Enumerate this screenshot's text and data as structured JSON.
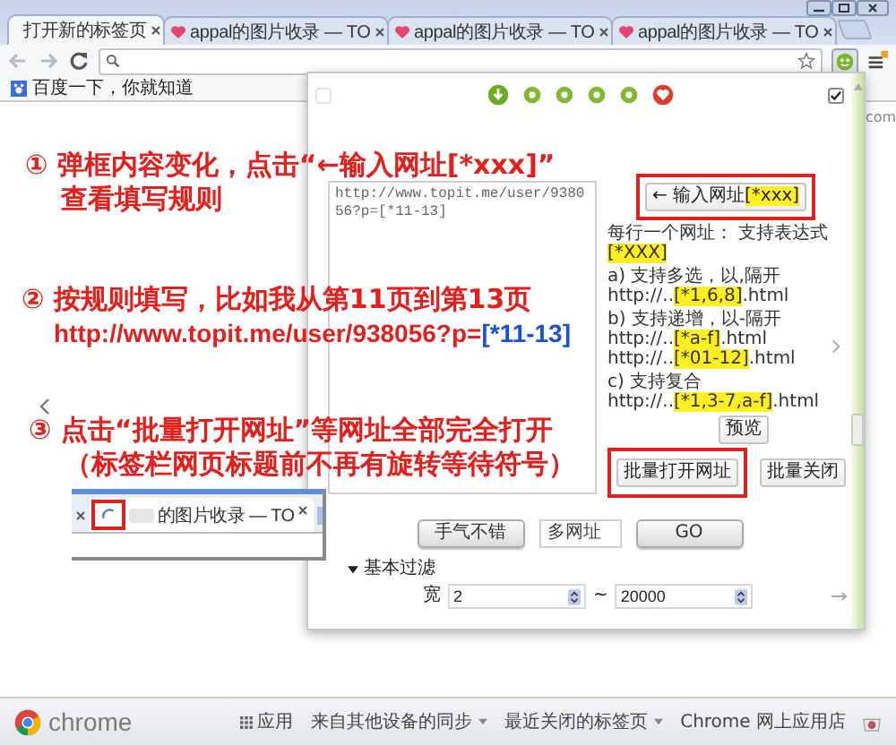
{
  "browser": {
    "tabs": [
      {
        "title": "打开新的标签页",
        "selected": true,
        "kind": "plain"
      },
      {
        "title": "appal的图片收录 — TO",
        "selected": false,
        "kind": "heart"
      },
      {
        "title": "appal的图片收录 — TO",
        "selected": false,
        "kind": "heart"
      },
      {
        "title": "appal的图片收录 — TO",
        "selected": false,
        "kind": "heart"
      }
    ],
    "bookmarks": [
      {
        "label": "百度一下，你就知道"
      }
    ]
  },
  "page": {
    "peek_text": "com",
    "footer_brand": "chrome",
    "footer_links": [
      {
        "label": "应用",
        "kind": "apps"
      },
      {
        "label": "来自其他设备的同步",
        "kind": "menu"
      },
      {
        "label": "最近关闭的标签页",
        "kind": "menu"
      },
      {
        "label": "Chrome 网上应用店",
        "kind": "store"
      }
    ]
  },
  "popup": {
    "options": [
      {
        "checked": false
      },
      {
        "checked": true
      }
    ],
    "url_text": "http://www.topit.me/user/938056?p=[*11-13]",
    "input_button": {
      "marked": true,
      "parts": [
        {
          "text": "← 输入网址",
          "highlight": false
        },
        {
          "text": "[*xxx]",
          "highlight": true
        }
      ]
    },
    "help_blocks": [
      {
        "lines": [
          [
            {
              "text": "每行一个网址：  支持表达式 ",
              "highlight": false
            },
            {
              "text": "[*XXX]",
              "highlight": true
            }
          ]
        ]
      },
      {
        "lines": [
          [
            {
              "text": "a) 支持多选，以,隔开",
              "highlight": false
            }
          ],
          [
            {
              "text": "http://..",
              "highlight": false
            },
            {
              "text": "[*1,6,8]",
              "highlight": true
            },
            {
              "text": ".html",
              "highlight": false
            }
          ]
        ]
      },
      {
        "lines": [
          [
            {
              "text": "b) 支持递增，以-隔开",
              "highlight": false
            }
          ],
          [
            {
              "text": "http://..",
              "highlight": false
            },
            {
              "text": "[*a-f]",
              "highlight": true
            },
            {
              "text": ".html",
              "highlight": false
            }
          ],
          [
            {
              "text": "http://..",
              "highlight": false
            },
            {
              "text": "[*01-12]",
              "highlight": true
            },
            {
              "text": ".html",
              "highlight": false
            }
          ]
        ]
      },
      {
        "lines": [
          [
            {
              "text": "c) 支持复合",
              "highlight": false
            }
          ],
          [
            {
              "text": "http://..",
              "highlight": false
            },
            {
              "text": "[*1,3-7,a-f]",
              "highlight": true
            },
            {
              "text": ".html",
              "highlight": false
            }
          ]
        ]
      }
    ],
    "preview_button": "预览",
    "batch_buttons": [
      {
        "label": "批量打开网址",
        "marked": true
      },
      {
        "label": "批量关闭",
        "marked": false
      }
    ],
    "lucky_button": "手气不错",
    "mode_field": "多网址",
    "go_button": "GO",
    "filter": {
      "title": "基本过滤",
      "expanded": true,
      "label": "宽",
      "min": "2",
      "separator": "~",
      "max": "20000"
    }
  },
  "annotations": [
    {
      "lines": [
        [
          {
            "text": "① 弹框内容变化，点击“←输入网址[*xxx]”",
            "emphasis": false
          }
        ],
        [
          {
            "text": "查看填写规则",
            "emphasis": false
          }
        ]
      ]
    },
    {
      "lines": [
        [
          {
            "text": "② 按规则填写，比如我从第11页到第13页",
            "emphasis": false
          }
        ],
        [
          {
            "text": "http://www.topit.me/user/938056?p=",
            "emphasis": false
          },
          {
            "text": "[*11-13]",
            "emphasis": true
          }
        ]
      ]
    },
    {
      "lines": [
        [
          {
            "text": "③ 点击“批量打开网址”等网址全部完全打开",
            "emphasis": false
          }
        ],
        [
          {
            "text": "（标签栏网页标题前不再有旋转等待符号）",
            "emphasis": false
          }
        ]
      ]
    }
  ],
  "inset": {
    "tab_title": "的图片收录 — TO"
  }
}
